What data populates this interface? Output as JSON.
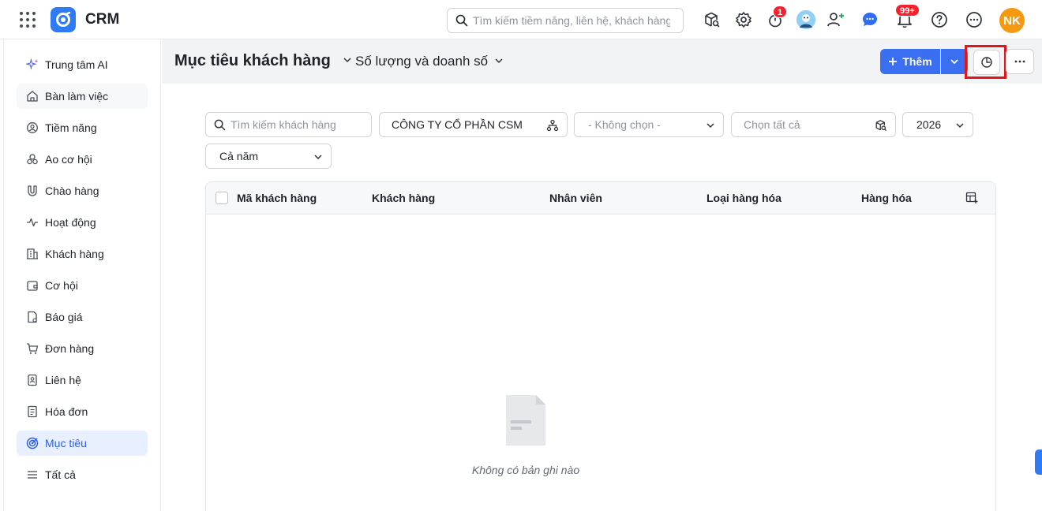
{
  "app": {
    "title": "CRM"
  },
  "topbar": {
    "search_placeholder": "Tìm kiếm tiềm năng, liên hệ, khách hàng",
    "timer_badge": "1",
    "notification_badge": "99+",
    "avatar_initials": "NK",
    "avatar_color": "#f59a0e"
  },
  "sidebar": {
    "items": [
      {
        "label": "Trung tâm AI",
        "icon": "ai-sparkle-icon"
      },
      {
        "label": "Bàn làm việc",
        "icon": "home-icon"
      },
      {
        "label": "Tiềm năng",
        "icon": "lead-icon"
      },
      {
        "label": "Ao cơ hội",
        "icon": "people-icon"
      },
      {
        "label": "Chào hàng",
        "icon": "magnet-icon"
      },
      {
        "label": "Hoạt động",
        "icon": "activity-icon"
      },
      {
        "label": "Khách hàng",
        "icon": "building-icon"
      },
      {
        "label": "Cơ hội",
        "icon": "wallet-icon"
      },
      {
        "label": "Báo giá",
        "icon": "quote-icon"
      },
      {
        "label": "Đơn hàng",
        "icon": "cart-icon"
      },
      {
        "label": "Liên hệ",
        "icon": "contact-icon"
      },
      {
        "label": "Hóa đơn",
        "icon": "invoice-icon"
      },
      {
        "label": "Mục tiêu",
        "icon": "target-icon"
      },
      {
        "label": "Tất cả",
        "icon": "menu-icon"
      }
    ],
    "active": "Mục tiêu",
    "accent_color": "#2f5fe0"
  },
  "header": {
    "title": "Mục tiêu khách hàng",
    "view_selector": "Số lượng và doanh số",
    "add_label": "Thêm",
    "primary_color": "#3a6ff2",
    "highlight_color": "#e4141b"
  },
  "filters": {
    "customer_search_placeholder": "Tìm kiếm khách hàng",
    "company": "CÔNG TY CỔ PHẦN CSM",
    "unselected": "- Không chọn -",
    "select_all_placeholder": "Chọn tất cả",
    "year": "2026",
    "period": "Cả năm"
  },
  "table": {
    "columns": [
      "Mã khách hàng",
      "Khách hàng",
      "Nhân viên",
      "Loại hàng hóa",
      "Hàng hóa"
    ],
    "rows": [],
    "empty_message": "Không có bản ghi nào"
  }
}
